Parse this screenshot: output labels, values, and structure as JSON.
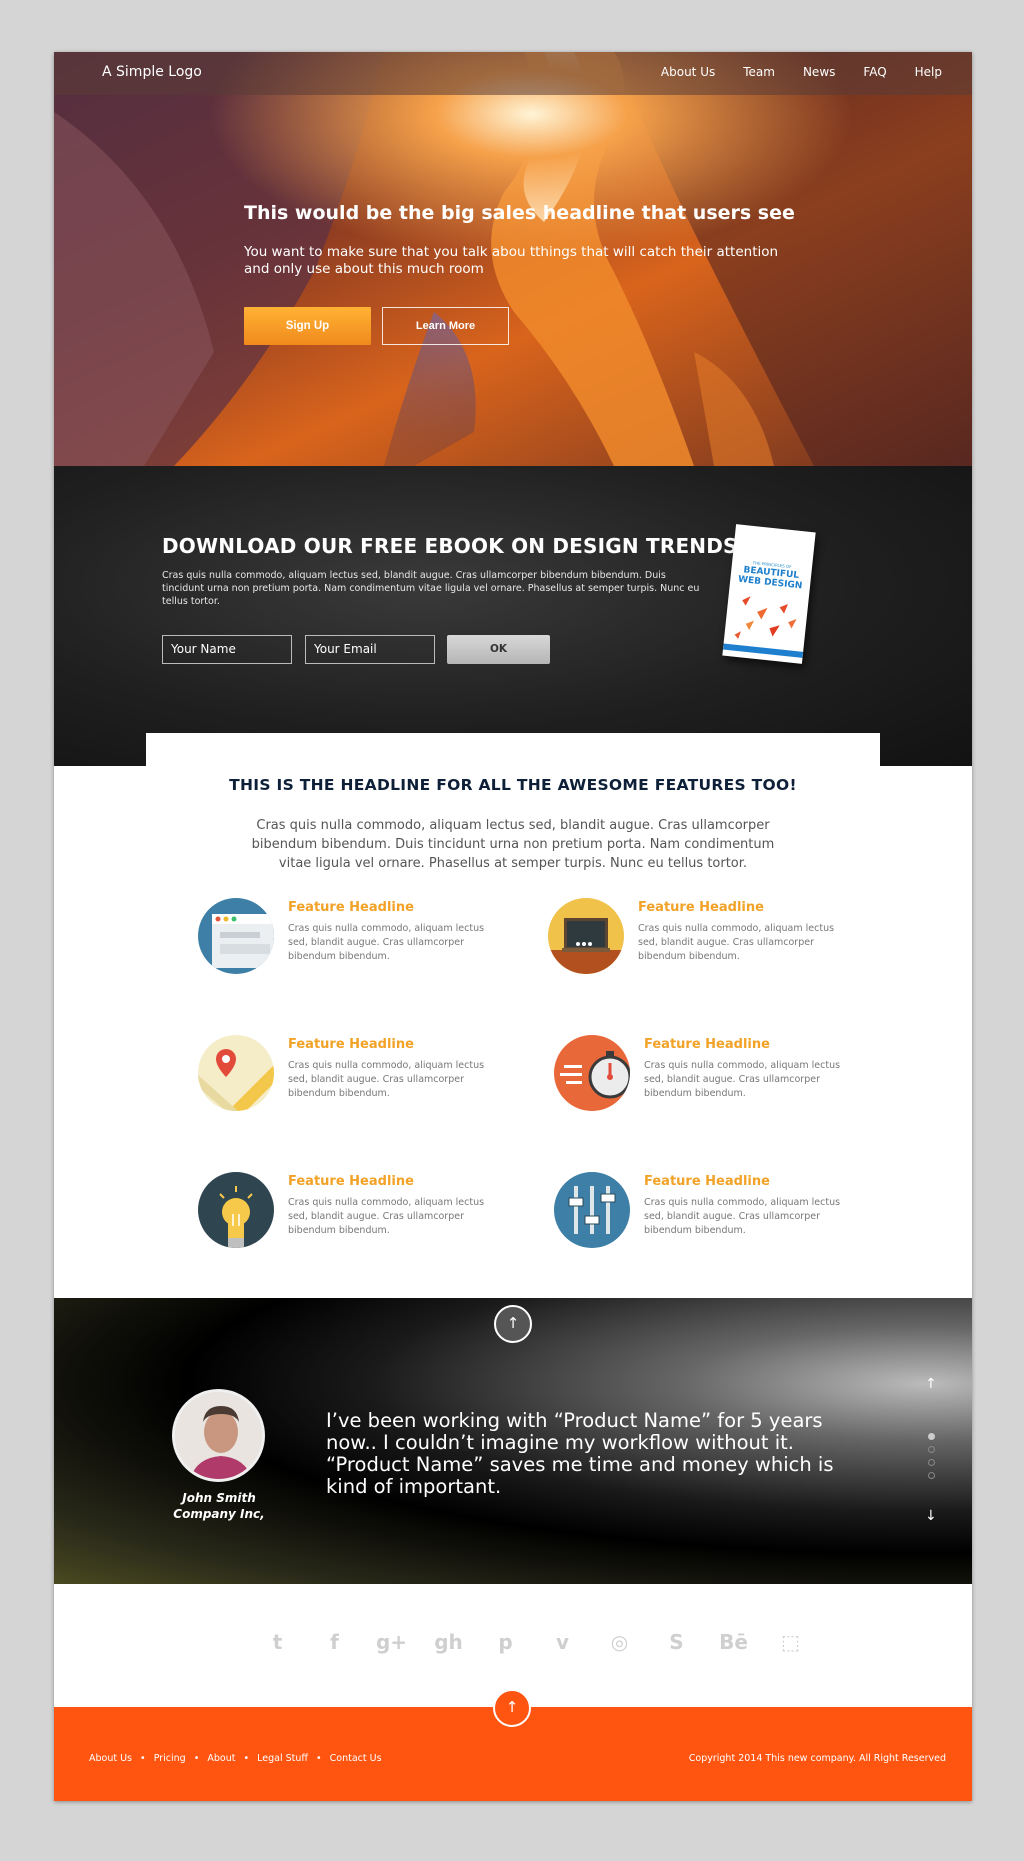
{
  "nav": {
    "logo": "A Simple Logo",
    "links": [
      "About Us",
      "Team",
      "News",
      "FAQ",
      "Help"
    ]
  },
  "hero": {
    "headline": "This would be the big sales headline that users see",
    "subtext": "You want to make sure that you talk abou tthings that will catch their attention and only use about this much room",
    "signup_label": "Sign Up",
    "learn_label": "Learn More"
  },
  "ebook": {
    "headline": "DOWNLOAD OUR FREE EBOOK ON DESIGN TRENDS.",
    "body": "Cras quis nulla commodo, aliquam lectus sed, blandit augue. Cras ullamcorper bibendum bibendum. Duis tincidunt urna non pretium porta. Nam condimentum vitae ligula vel ornare. Phasellus at semper turpis. Nunc eu tellus tortor.",
    "name_placeholder": "Your Name",
    "email_placeholder": "Your Email",
    "ok_label": "OK",
    "book_subtitle": "THE PRINCIPLES OF",
    "book_title": "BEAUTIFUL WEB DESIGN"
  },
  "features": {
    "headline": "THIS IS THE HEADLINE FOR ALL THE AWESOME FEATURES TOO!",
    "body": "Cras quis nulla commodo, aliquam lectus sed, blandit augue. Cras ullamcorper bibendum bibendum. Duis tincidunt urna non pretium porta. Nam condimentum vitae ligula vel ornare. Phasellus at semper turpis. Nunc eu tellus tortor.",
    "items": [
      {
        "title": "Feature Headline",
        "text": "Cras quis nulla commodo, aliquam lectus sed, blandit augue. Cras ullamcorper bibendum bibendum.",
        "icon": "browser-icon"
      },
      {
        "title": "Feature Headline",
        "text": "Cras quis nulla commodo, aliquam lectus sed, blandit augue. Cras ullamcorper bibendum bibendum.",
        "icon": "chalkboard-icon"
      },
      {
        "title": "Feature Headline",
        "text": "Cras quis nulla commodo, aliquam lectus sed, blandit augue. Cras ullamcorper bibendum bibendum.",
        "icon": "map-pin-icon"
      },
      {
        "title": "Feature Headline",
        "text": "Cras quis nulla commodo, aliquam lectus sed, blandit augue. Cras ullamcorper bibendum bibendum.",
        "icon": "stopwatch-icon"
      },
      {
        "title": "Feature Headline",
        "text": "Cras quis nulla commodo, aliquam lectus sed, blandit augue. Cras ullamcorper bibendum bibendum.",
        "icon": "lightbulb-icon"
      },
      {
        "title": "Feature Headline",
        "text": "Cras quis nulla commodo, aliquam lectus sed, blandit augue. Cras ullamcorper bibendum bibendum.",
        "icon": "sliders-icon"
      }
    ]
  },
  "testimonial": {
    "quote": "I’ve been working with “Product Name” for 5 years now.. I couldn’t imagine my workflow without it. “Product Name” saves me time and money which is kind of important.",
    "name": "John Smith",
    "company": "Company Inc,"
  },
  "social": [
    "t",
    "f",
    "g+",
    "gh",
    "p",
    "v",
    "◎",
    "S",
    "Bē",
    "⬚"
  ],
  "footer": {
    "links": [
      "About Us",
      "•",
      "Pricing",
      "•",
      "About",
      "•",
      "Legal Stuff",
      "•",
      "Contact Us"
    ],
    "copyright": "Copyright 2014 This new company. All Right Reserved"
  },
  "colors": {
    "accent_orange": "#ff5510",
    "feature_title": "#f2a227",
    "signup": "#f59a24"
  }
}
